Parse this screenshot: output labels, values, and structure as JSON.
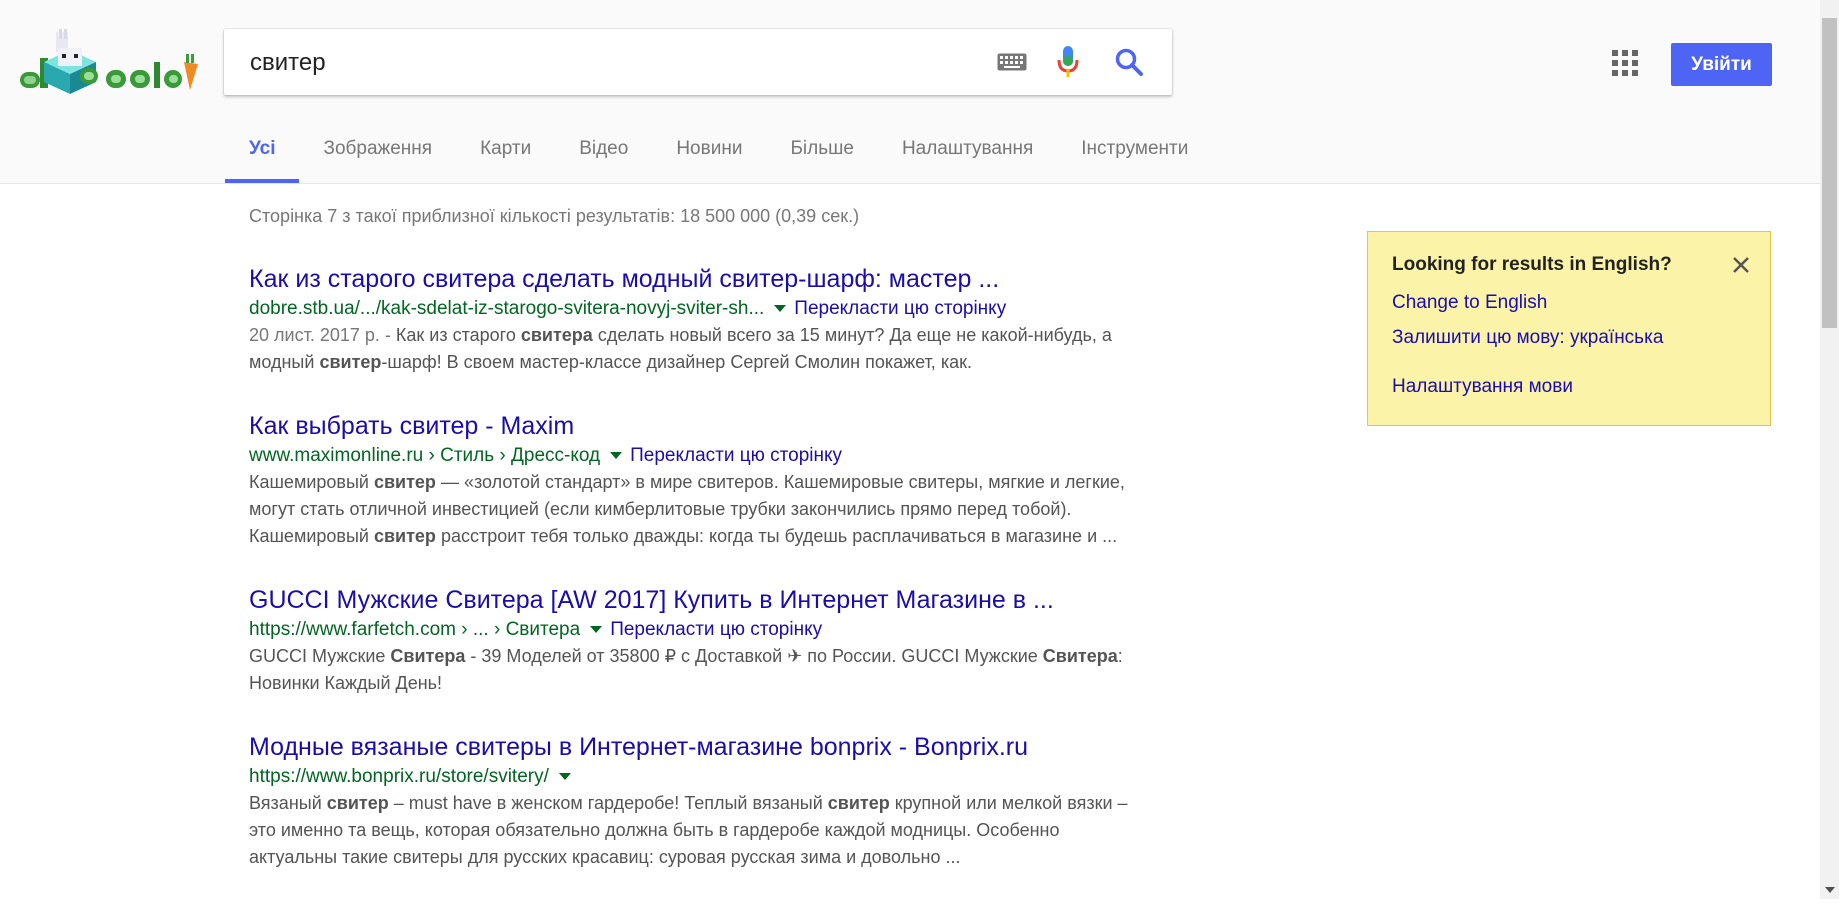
{
  "search": {
    "query": "свитер"
  },
  "header": {
    "signin_label": "Увійти",
    "logo_icon": "doodle-logo-icon"
  },
  "tabs": [
    {
      "label": "Усі",
      "active": true
    },
    {
      "label": "Зображення"
    },
    {
      "label": "Карти"
    },
    {
      "label": "Відео"
    },
    {
      "label": "Новини"
    },
    {
      "label": "Більше"
    },
    {
      "label": "Налаштування"
    },
    {
      "label": "Інструменти"
    }
  ],
  "stats": "Сторінка 7 з такої приблизної кількості результатів: 18 500 000 (0,39 сек.)",
  "results": [
    {
      "title": "Как из старого свитера сделать модный свитер-шарф: мастер ...",
      "url": "dobre.stb.ua/.../kak-sdelat-iz-starogo-svitera-novyj-sviter-sh...",
      "translate": "Перекласти цю сторінку",
      "date": "20 лист. 2017 р. - ",
      "snippet_parts": [
        [
          "Как из старого ",
          false
        ],
        [
          "свитера",
          true
        ],
        [
          " сделать новый всего за 15 минут? Да еще не какой-нибудь, а модный ",
          false
        ],
        [
          "свитер",
          true
        ],
        [
          "-шарф! В своем мастер-классе дизайнер Сергей Смолин покажет, как.",
          false
        ]
      ]
    },
    {
      "title": "Как выбрать свитер - Maxim",
      "url": "www.maximonline.ru › Стиль › Дресс-код",
      "translate": "Перекласти цю сторінку",
      "date": "",
      "snippet_parts": [
        [
          "Кашемировый ",
          false
        ],
        [
          "свитер",
          true
        ],
        [
          " — «золотой стандарт» в мире свитеров. Кашемировые свитеры, мягкие и легкие, могут стать отличной инвестицией (если кимберлитовые трубки закончились прямо перед тобой). Кашемировый ",
          false
        ],
        [
          "свитер",
          true
        ],
        [
          " расстроит тебя только дважды: когда ты будешь расплачиваться в магазине и ...",
          false
        ]
      ]
    },
    {
      "title": "GUCCI Мужские Свитера [AW 2017] Купить в Интернет Магазине в ...",
      "url": "https://www.farfetch.com › ... › Свитера",
      "translate": "Перекласти цю сторінку",
      "date": "",
      "snippet_parts": [
        [
          "GUCCI Мужские ",
          false
        ],
        [
          "Свитера",
          true
        ],
        [
          " - 39 Моделей от 35800 ₽ с Доставкой ✈ по России. GUCCI Мужские ",
          false
        ],
        [
          "Свитера",
          true
        ],
        [
          ": Новинки Каждый День!",
          false
        ]
      ]
    },
    {
      "title": "Модные вязаные свитеры в Интернет-магазине bonprix - Bonprix.ru",
      "url": "https://www.bonprix.ru/store/svitery/",
      "translate": "",
      "date": "",
      "snippet_parts": [
        [
          "Вязаный ",
          false
        ],
        [
          "свитер",
          true
        ],
        [
          " – must have в женском гардеробе! Теплый вязаный ",
          false
        ],
        [
          "свитер",
          true
        ],
        [
          " крупной или мелкой вязки – это именно та вещь, которая обязательно должна быть в гардеробе каждой модницы. Особенно актуальны такие свитеры для русских красавиц: суровая русская зима и довольно ...",
          false
        ]
      ]
    }
  ],
  "lang_box": {
    "title": "Looking for results in English?",
    "change": "Change to English",
    "keep": "Залишити цю мову: українська",
    "settings": "Налаштування мови"
  },
  "colors": {
    "accent": "#4d64f4",
    "link": "#1a0dab",
    "url": "#006621",
    "notice_bg": "#fbf3a8"
  }
}
